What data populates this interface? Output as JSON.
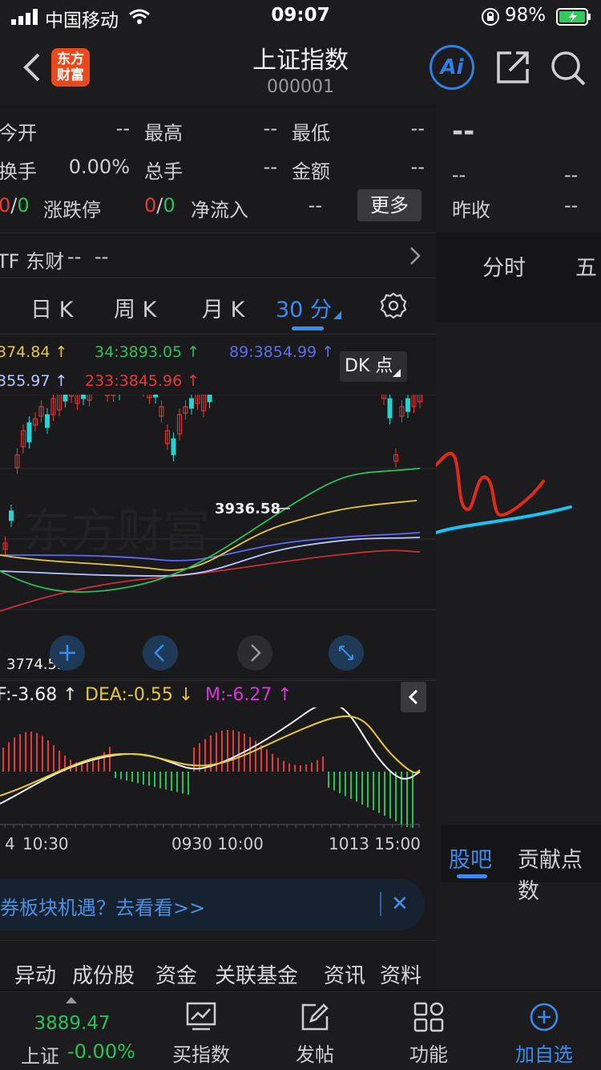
{
  "status": {
    "carrier": "中国移动",
    "time": "09:07",
    "battery": "98%"
  },
  "nav": {
    "title": "上证指数",
    "code": "000001",
    "logo_line1": "东方",
    "logo_line2": "财富",
    "ai": "Ai"
  },
  "quote": {
    "row1": [
      {
        "label": "今开",
        "value": "--"
      },
      {
        "label": "最高",
        "value": "--"
      },
      {
        "label": "最低",
        "value": "--"
      }
    ],
    "row2": [
      {
        "label": "换手",
        "value": "0.00%"
      },
      {
        "label": "总手",
        "value": "--"
      },
      {
        "label": "金额",
        "value": "--"
      }
    ],
    "row3": {
      "updown_a": "0",
      "slash": "/",
      "updown_b": "0",
      "limit_label": "涨跌停",
      "limit_a": "0",
      "limit_b": "0",
      "flow_label": "净流入",
      "flow_value": "--",
      "more": "更多"
    },
    "etf": {
      "label": "TF 东财",
      "v1": "--",
      "v2": "--"
    }
  },
  "ktabs": {
    "day": "日 K",
    "week": "周 K",
    "month": "月 K",
    "min30": "30 分"
  },
  "ma": {
    "a": "374.84 ↑",
    "b": "34:3893.05 ↑",
    "c": "89:3854.99 ↑",
    "d": "355.97 ↑",
    "e": "233:3845.96 ↑",
    "dk": "DK 点"
  },
  "chart_labels": {
    "high": "3936.58",
    "low": "3774.53",
    "watermark": "东方财富"
  },
  "macd": {
    "dif": "F:-3.68 ↑",
    "dea": "DEA:-0.55 ↓",
    "m": "M:-6.27 ↑"
  },
  "xaxis": {
    "t1": "4",
    "t2": "10:30",
    "t3": "0930 10:00",
    "t4": "1013 15:00"
  },
  "ad": {
    "text": "券板块机遇？去看看>>",
    "close": "✕"
  },
  "bottom_tabs": [
    "异动",
    "成份股",
    "资金",
    "关联基金",
    "资讯",
    "资料"
  ],
  "right": {
    "price": "--",
    "r1a": "--",
    "r1b": "--",
    "prev_label": "昨收",
    "prev_value": "--",
    "tab1": "分时",
    "tab2": "五",
    "bar_tab1": "股吧",
    "bar_tab2": "贡献点数"
  },
  "toolbar": {
    "price": "3889.47",
    "name": "上证",
    "change": "-0.00%",
    "buy": "买指数",
    "post": "发帖",
    "func": "功能",
    "add": "加自选"
  },
  "colors": {
    "up": "#e53a3a",
    "down": "#2ac05a",
    "accent": "#3b8cf0",
    "candle_up": "#e53a3a",
    "candle_down": "#29d1d1"
  }
}
